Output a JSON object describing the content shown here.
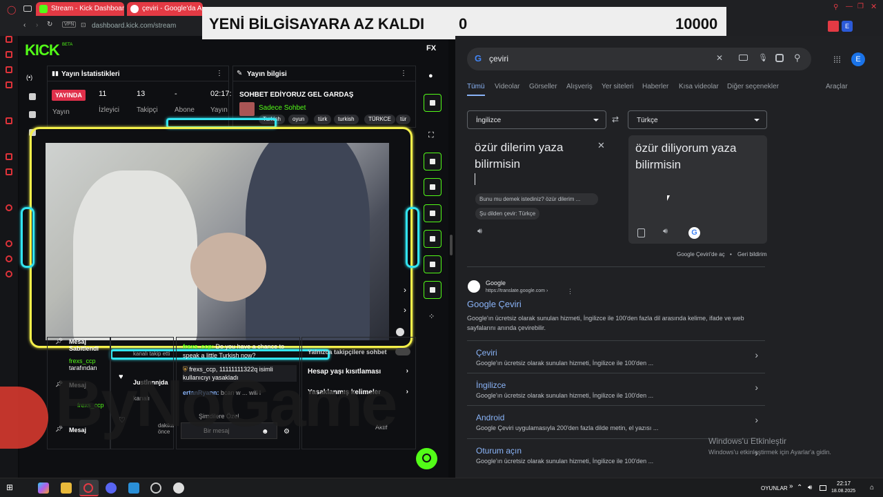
{
  "browser": {
    "tabs": [
      {
        "label": "Stream - Kick Dashboard"
      },
      {
        "label": "çeviri - Google'da Ara"
      }
    ],
    "url_prefix": "VPN",
    "url": "dashboard.kick.com/stream"
  },
  "overlay": {
    "title": "YENİ BİLGİSAYARA AZ KALDI",
    "current": "0",
    "goal": "10000"
  },
  "kick": {
    "logo": "KICK",
    "beta": "BETA",
    "stats_panel": {
      "title": "Yayın İstatistikleri",
      "live_badge": "YAYINDA",
      "live_label": "Yayın",
      "stats": [
        {
          "value": "11",
          "label": "İzleyici"
        },
        {
          "value": "13",
          "label": "Takipçi"
        },
        {
          "value": "-",
          "label": "Abone"
        },
        {
          "value": "02:17:",
          "label": "Yayın"
        }
      ]
    },
    "info_panel": {
      "title": "Yayın bilgisi",
      "stream_title": "SOHBET EDİYORUZ GEL GARDAŞ",
      "category": "Sadece Sohbet",
      "tags": [
        "Turkish",
        "oyun",
        "türk",
        "turkish",
        "TÜRKCE",
        "tür"
      ]
    },
    "activity": [
      {
        "label": "Mesaj",
        "sub": "Sabitlendi"
      },
      {
        "user": "frexs_ccp",
        "sub": "tarafından"
      },
      {
        "label": "Mesaj"
      },
      {
        "user": "frexs_ccp"
      },
      {
        "label": "Mesaj"
      }
    ],
    "follow": [
      {
        "user": "Justinnnjda",
        "sub": "kanalı"
      },
      {
        "sub": "kanalı takip etti"
      },
      {
        "sub": "dakika önce"
      }
    ],
    "chat": [
      {
        "user": "frexs_ccp:",
        "text": "Do you have a chance to speak a little Turkish now?"
      },
      {
        "user": "frexs_ccp,",
        "text": "11111111322q isimli kullanıcıyı yasakladı"
      },
      {
        "user": "ertanRyann:",
        "text": "bcan w ... will l"
      }
    ],
    "chat_input_placeholder": "Bir mesaj",
    "chat_hint": "Şimdilere Özel",
    "settings": [
      {
        "label": "Yalnızca takipçilere sohbet"
      },
      {
        "label": "Hesap yaşı kısıtlaması"
      },
      {
        "label": "Yasaklanmış kelimeler"
      },
      {
        "label": "Aktif"
      }
    ]
  },
  "watermark": "ByNoGame",
  "google": {
    "query": "çeviri",
    "tabs": [
      "Tümü",
      "Videolar",
      "Görseller",
      "Alışveriş",
      "Yer siteleri",
      "Haberler",
      "Kısa videolar",
      "Diğer seçenekler",
      "Araçlar"
    ],
    "source_lang": "İngilizce",
    "target_lang": "Türkçe",
    "source_text": "özür dilerim yaza bilirmisin",
    "target_text": "özür diliyorum yaza bilirmisin",
    "did_you_mean": "Bunu mu demek istediniz? özür dilerim ...",
    "translate_from": "Şu dilden çevir: Türkçe",
    "open_link": "Google Çeviri'de aç",
    "feedback": "Geri bildirim",
    "result": {
      "site": "Google",
      "url": "https://translate.google.com ›",
      "title": "Google Çeviri",
      "desc": "Google'ın ücretsiz olarak sunulan hizmeti, İngilizce ile 100'den fazla dil arasında kelime, ifade ve web sayfalarını anında çevirebilir.",
      "sublinks": [
        {
          "title": "Çeviri",
          "desc": "Google'ın ücretsiz olarak sunulan hizmeti, İngilizce ile 100'den ..."
        },
        {
          "title": "İngilizce",
          "desc": "Google'ın ücretsiz olarak sunulan hizmeti, İngilizce ile 100'den ..."
        },
        {
          "title": "Android",
          "desc": "Google Çeviri uygulamasıyla 200'den fazla dilde metin, el yazısı ..."
        },
        {
          "title": "Oturum açın",
          "desc": "Google'ın ücretsiz olarak sunulan hizmeti, İngilizce ile 100'den ..."
        }
      ]
    },
    "avatar": "E"
  },
  "windows": {
    "activate_title": "Windows'u Etkinleştir",
    "activate_desc": "Windows'u etkinleştirmek için Ayarlar'a gidin."
  },
  "taskbar": {
    "tray_label": "OYUNLAR",
    "time": "22:17",
    "date": "18.08.2025"
  },
  "colors": {
    "kick_green": "#53fc18",
    "frame_yellow": "#f4f04a",
    "frame_cyan": "#32e4f0",
    "google_blue": "#8ab4f8"
  }
}
